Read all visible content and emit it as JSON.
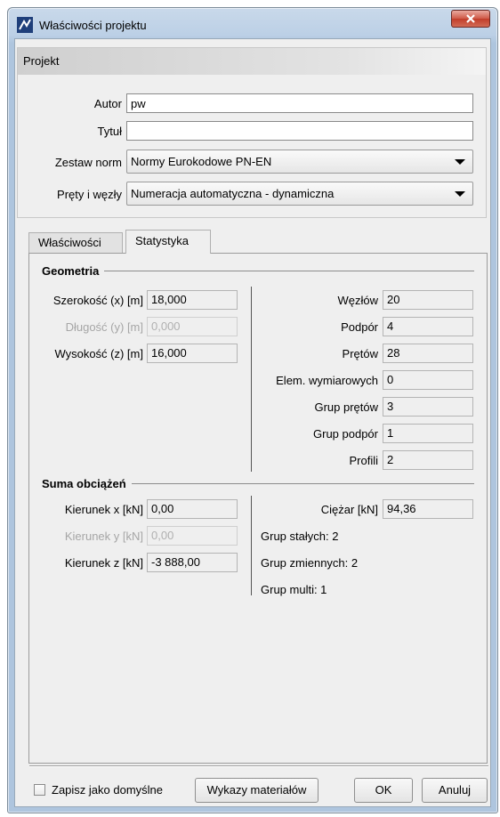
{
  "window": {
    "title": "Właściwości projektu"
  },
  "projekt": {
    "header": "Projekt",
    "autor_label": "Autor",
    "autor_value": "pw",
    "tytul_label": "Tytuł",
    "tytul_value": "",
    "norms_label": "Zestaw norm",
    "norms_value": "Normy Eurokodowe PN-EN",
    "numbering_label": "Pręty i węzły",
    "numbering_value": "Numeracja automatyczna - dynamiczna"
  },
  "tabs": [
    {
      "label": "Właściwości"
    },
    {
      "label": "Statystyka"
    }
  ],
  "geometria": {
    "title": "Geometria",
    "left": [
      {
        "label": "Szerokość (x) [m]",
        "value": "18,000",
        "disabled": false
      },
      {
        "label": "Długość (y) [m]",
        "value": "0,000",
        "disabled": true
      },
      {
        "label": "Wysokość (z) [m]",
        "value": "16,000",
        "disabled": false
      }
    ],
    "right": [
      {
        "label": "Węzłów",
        "value": "20"
      },
      {
        "label": "Podpór",
        "value": "4"
      },
      {
        "label": "Prętów",
        "value": "28"
      },
      {
        "label": "Elem. wymiarowych",
        "value": "0"
      },
      {
        "label": "Grup prętów",
        "value": "3"
      },
      {
        "label": "Grup podpór",
        "value": "1"
      },
      {
        "label": "Profili",
        "value": "2"
      }
    ]
  },
  "obciazenia": {
    "title": "Suma obciążeń",
    "left": [
      {
        "label": "Kierunek x [kN]",
        "value": "0,00",
        "disabled": false
      },
      {
        "label": "Kierunek y [kN]",
        "value": "0,00",
        "disabled": true
      },
      {
        "label": "Kierunek z [kN]",
        "value": "-3 888,00",
        "disabled": false
      }
    ],
    "ciezar_label": "Ciężar [kN]",
    "ciezar_value": "94,36",
    "stats": [
      "Grup stałych: 2",
      "Grup zmiennych: 2",
      "Grup multi: 1"
    ]
  },
  "footer": {
    "checkbox_label": "Zapisz jako domyślne",
    "checkbox_checked": false,
    "materials_button": "Wykazy materiałów",
    "ok_button": "OK",
    "cancel_button": "Anuluj"
  },
  "colors": {
    "titlebar": "#bcd0e6",
    "close_button": "#c13d2a",
    "panel_bg": "#efefef"
  }
}
